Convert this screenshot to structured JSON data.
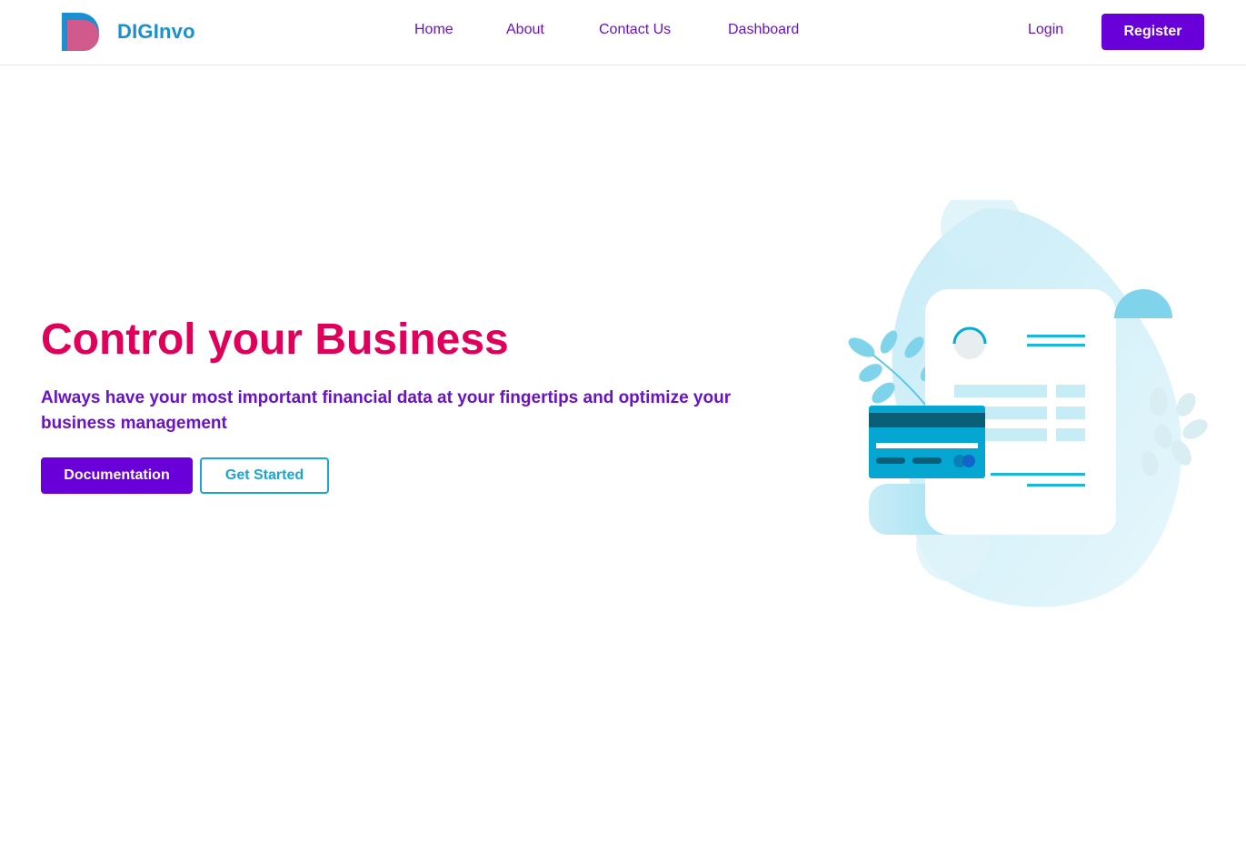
{
  "brand": {
    "name": "DIGInvo",
    "logo_icon": "d-letter-logo-icon"
  },
  "nav": {
    "links": [
      {
        "label": "Home"
      },
      {
        "label": "About"
      },
      {
        "label": "Contact Us"
      },
      {
        "label": "Dashboard"
      }
    ],
    "login_label": "Login",
    "register_label": "Register"
  },
  "hero": {
    "title": "Control your Business",
    "subtitle": "Always have your most important financial data at your fingertips and optimize your business management",
    "primary_button": "Documentation",
    "secondary_button": "Get Started",
    "illustration_icon": "invoice-credit-card-illustration"
  },
  "colors": {
    "brand_blue": "#1a8fd1",
    "brand_pink": "#d05a8c",
    "nav_purple": "#6a12c9",
    "primary_button": "#6a00d9",
    "hero_title": "#e0005a",
    "accent_cyan": "#19a5d6",
    "illustration_light": "#d6f1fa",
    "illustration_card": "#05a6d1"
  }
}
